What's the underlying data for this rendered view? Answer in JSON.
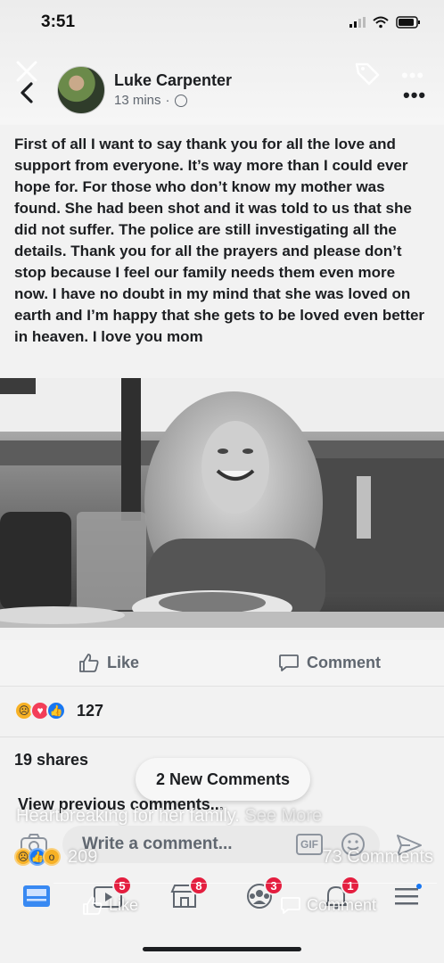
{
  "status": {
    "time": "3:51"
  },
  "post": {
    "author": "Luke Carpenter",
    "timestamp": "13 mins",
    "separator": "·",
    "body": "First of all I want to say thank you for all the love and support from everyone. It’s way more than I could ever hope for. For those who don’t know my mother was found. She had been shot and it was told to us that she did not suffer. The police are still investigating all the details. Thank you for all the prayers and please don’t stop because I feel our family needs them even more now. I have no doubt in my mind that she was loved on earth and I’m happy that she gets to be loved even better in heaven. I love you mom"
  },
  "actions": {
    "like": "Like",
    "comment": "Comment"
  },
  "reactions": {
    "count": "127"
  },
  "shares": "19 shares",
  "new_comments": "2 New Comments",
  "view_previous": "View previous comments...",
  "comment_input": {
    "placeholder": "Write a comment...",
    "gif": "GIF"
  },
  "overlay": {
    "caption": "Heartbreaking for her family.",
    "see_more": "See More",
    "reaction_count": "209",
    "comments_count": "73 Comments",
    "like": "Like",
    "comment": "Comment"
  },
  "tabbar": {
    "badges": {
      "watch": "5",
      "marketplace": "8",
      "groups": "3",
      "notifications": "1"
    }
  },
  "colors": {
    "badge": "#e41e3f",
    "like_blue": "#1877f2",
    "love_red": "#f33e58",
    "sad_yellow": "#f7b125"
  }
}
